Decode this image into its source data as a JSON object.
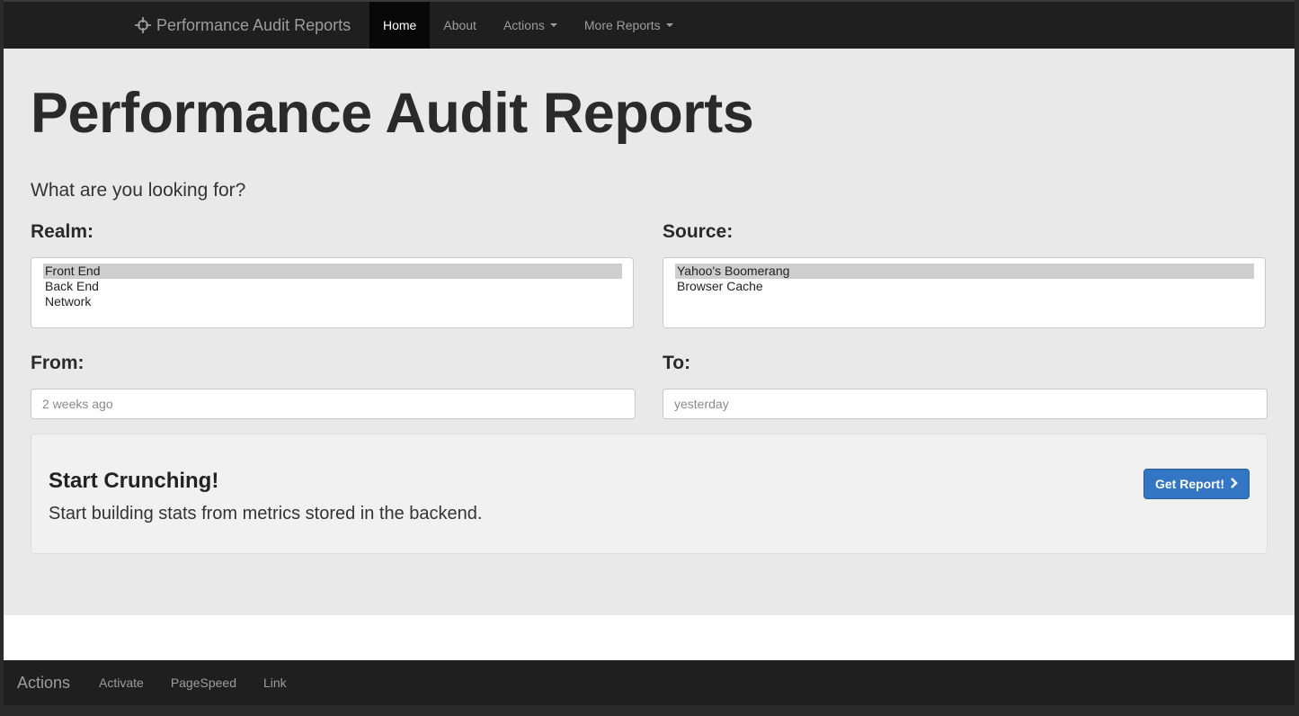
{
  "navbar": {
    "brand": "Performance Audit Reports",
    "brand_icon": "crosshair-icon",
    "items": [
      {
        "label": "Home",
        "active": true
      },
      {
        "label": "About"
      },
      {
        "label": "Actions",
        "dropdown": true
      },
      {
        "label": "More Reports",
        "dropdown": true
      }
    ]
  },
  "main": {
    "title": "Performance Audit Reports",
    "prompt": "What are you looking for?",
    "realm": {
      "label": "Realm:",
      "options": [
        "Front End",
        "Back End",
        "Network"
      ],
      "selected": "Front End"
    },
    "source": {
      "label": "Source:",
      "options": [
        "Yahoo's Boomerang",
        "Browser Cache"
      ],
      "selected": "Yahoo's Boomerang"
    },
    "from": {
      "label": "From:",
      "placeholder": "2 weeks ago",
      "value": ""
    },
    "to": {
      "label": "To:",
      "placeholder": "yesterday",
      "value": ""
    },
    "cta": {
      "title": "Start Crunching!",
      "description": "Start building stats from metrics stored in the backend.",
      "button_label": "Get Report!",
      "button_icon": "chevron-right-icon"
    }
  },
  "footer": {
    "brand": "Actions",
    "items": [
      "Activate",
      "PageSpeed",
      "Link"
    ]
  },
  "colors": {
    "navbar_bg": "#1f1f1f",
    "jumbotron_bg": "#e9e9e9",
    "primary_button": "#3276c4",
    "selected_option": "#cecece"
  }
}
